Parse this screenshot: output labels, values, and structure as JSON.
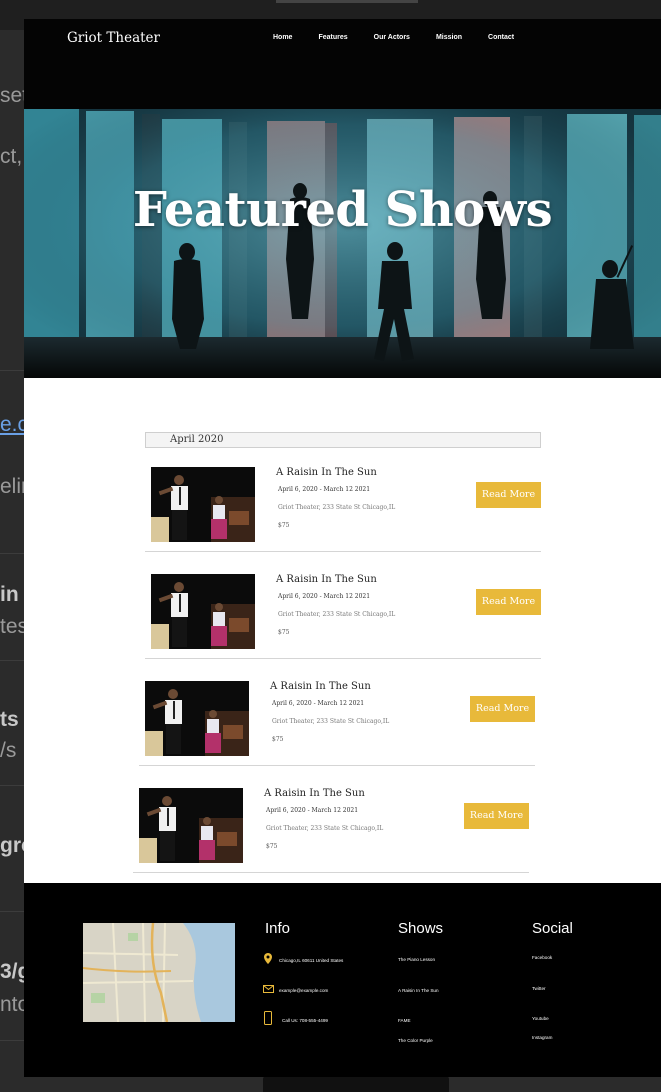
{
  "background": {
    "fragments": [
      "set",
      "ct,",
      "e.c",
      "elir",
      "in",
      "tes",
      "ts",
      "/s",
      "gro",
      "3/g",
      "nto"
    ]
  },
  "site": {
    "brand": "Griot Theater",
    "nav": [
      "Home",
      "Features",
      "Our Actors",
      "Mission",
      "Contact"
    ],
    "hero_title": "Featured Shows",
    "month_label": "April 2020",
    "events": [
      {
        "title": "A Raisin In The Sun",
        "dates": "April 6, 2020 - March 12 2021",
        "venue": "Griot Theater, 233 State St Chicago,IL",
        "price": "$75",
        "button": "Read More"
      },
      {
        "title": "A Raisin In The Sun",
        "dates": "April 6, 2020 - March 12 2021",
        "venue": "Griot Theater, 233 State St Chicago,IL",
        "price": "$75",
        "button": "Read More"
      },
      {
        "title": "A Raisin In The Sun",
        "dates": "April 6, 2020 - March 12 2021",
        "venue": "Griot Theater, 233 State St Chicago,IL",
        "price": "$75",
        "button": "Read More"
      },
      {
        "title": "A Raisin In The Sun",
        "dates": "April 6, 2020 - March 12 2021",
        "venue": "Griot Theater, 233 State St Chicago,IL",
        "price": "$75",
        "button": "Read More"
      }
    ],
    "footer": {
      "info": {
        "heading": "Info",
        "address": "Chicago,IL 60611 United States",
        "email": "example@example.com",
        "phone": "Call Us: 708-555-4499"
      },
      "shows": {
        "heading": "Shows",
        "items": [
          "The Piano Lesson",
          "A Raisin In The Sun",
          "FAME",
          "The Color Purple"
        ]
      },
      "social": {
        "heading": "Social",
        "items": [
          "Facebook",
          "Twitter",
          "Youtube",
          "Instagram"
        ]
      }
    }
  },
  "colors": {
    "button": "#e8b93a",
    "footer_bg": "#000000",
    "icon_accent": "#e8b93a"
  }
}
